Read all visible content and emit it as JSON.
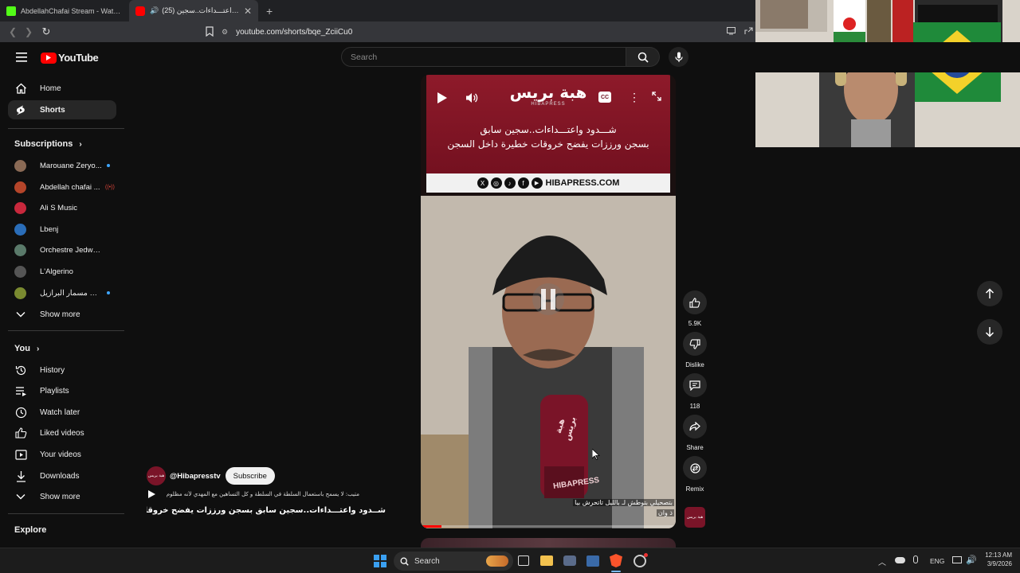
{
  "browser": {
    "tabs": [
      {
        "title": "AbdellahChafai Stream - Watch Live"
      },
      {
        "title": "(25) شـــدود واعتـــداءات..سجين"
      }
    ],
    "url": "youtube.com/shorts/bqe_ZciiCu0"
  },
  "youtube": {
    "logo_text": "YouTube",
    "search_placeholder": "Search"
  },
  "sidebar": {
    "main": [
      {
        "label": "Home",
        "icon": "home-icon"
      },
      {
        "label": "Shorts",
        "icon": "shorts-icon",
        "active": true
      }
    ],
    "subscriptions_title": "Subscriptions",
    "subscriptions": [
      {
        "name": "Marouane Zeryo...",
        "indicator": "dot",
        "color": "#8a6a55"
      },
      {
        "name": "Abdellah chafai ...",
        "indicator": "live",
        "color": "#b5452a"
      },
      {
        "name": "Ali S Music",
        "indicator": "",
        "color": "#c8283c"
      },
      {
        "name": "Lbenj",
        "indicator": "",
        "color": "#2a6db8"
      },
      {
        "name": "Orchestre Jedwane...",
        "indicator": "",
        "color": "#5a7a6a"
      },
      {
        "name": "L'Algerino",
        "indicator": "",
        "color": "#555555"
      },
      {
        "name": "مسمار البرازيل Mes...",
        "indicator": "dot",
        "color": "#7a8a30"
      }
    ],
    "sub_show_more": "Show more",
    "you_title": "You",
    "you_items": [
      {
        "label": "History",
        "icon": "history-icon"
      },
      {
        "label": "Playlists",
        "icon": "playlists-icon"
      },
      {
        "label": "Watch later",
        "icon": "watch-later-icon"
      },
      {
        "label": "Liked videos",
        "icon": "liked-icon"
      },
      {
        "label": "Your videos",
        "icon": "your-videos-icon"
      },
      {
        "label": "Downloads",
        "icon": "downloads-icon"
      }
    ],
    "you_show_more": "Show more",
    "explore_title": "Explore"
  },
  "video": {
    "banner_logo": "هبة بريس",
    "banner_logo_sub": "HIBAPRESS",
    "banner_line1": "شـــدود واعتـــداءات..سجين سابق",
    "banner_line2": "بسجن ورززات يفضح خروقات خطيرة داخل السجن",
    "banner_site": "HIBAPRESS.COM",
    "mic_brand": "هبة بريس",
    "mic_brand_latin": "HIBAPRESS",
    "subtitle_line1": "بتصحيلي بتوطش لـ بالليل تاتحرش بيا",
    "subtitle_line2": "ذ وان",
    "progress": 0.08
  },
  "channel": {
    "handle": "@Hibapresstv",
    "subscribe_label": "Subscribe",
    "avatar_text": "هبة بريس",
    "music_line": "متيب: لا يسمح باستعمال السلطة في السلطة و كل التساهين مع المهدي لأنه مظلوم",
    "title": "شــدود واعتـــداءات..سجين سابق بسجن ورززات يفضح خروقات..."
  },
  "actions": [
    {
      "name": "like",
      "label": "5.9K"
    },
    {
      "name": "dislike",
      "label": "Dislike"
    },
    {
      "name": "comments",
      "label": "118"
    },
    {
      "name": "share",
      "label": "Share"
    },
    {
      "name": "remix",
      "label": "Remix"
    }
  ],
  "taskbar": {
    "search_label": "Search",
    "language": "ENG",
    "time": "12:13 AM",
    "date": "3/9/2026"
  }
}
